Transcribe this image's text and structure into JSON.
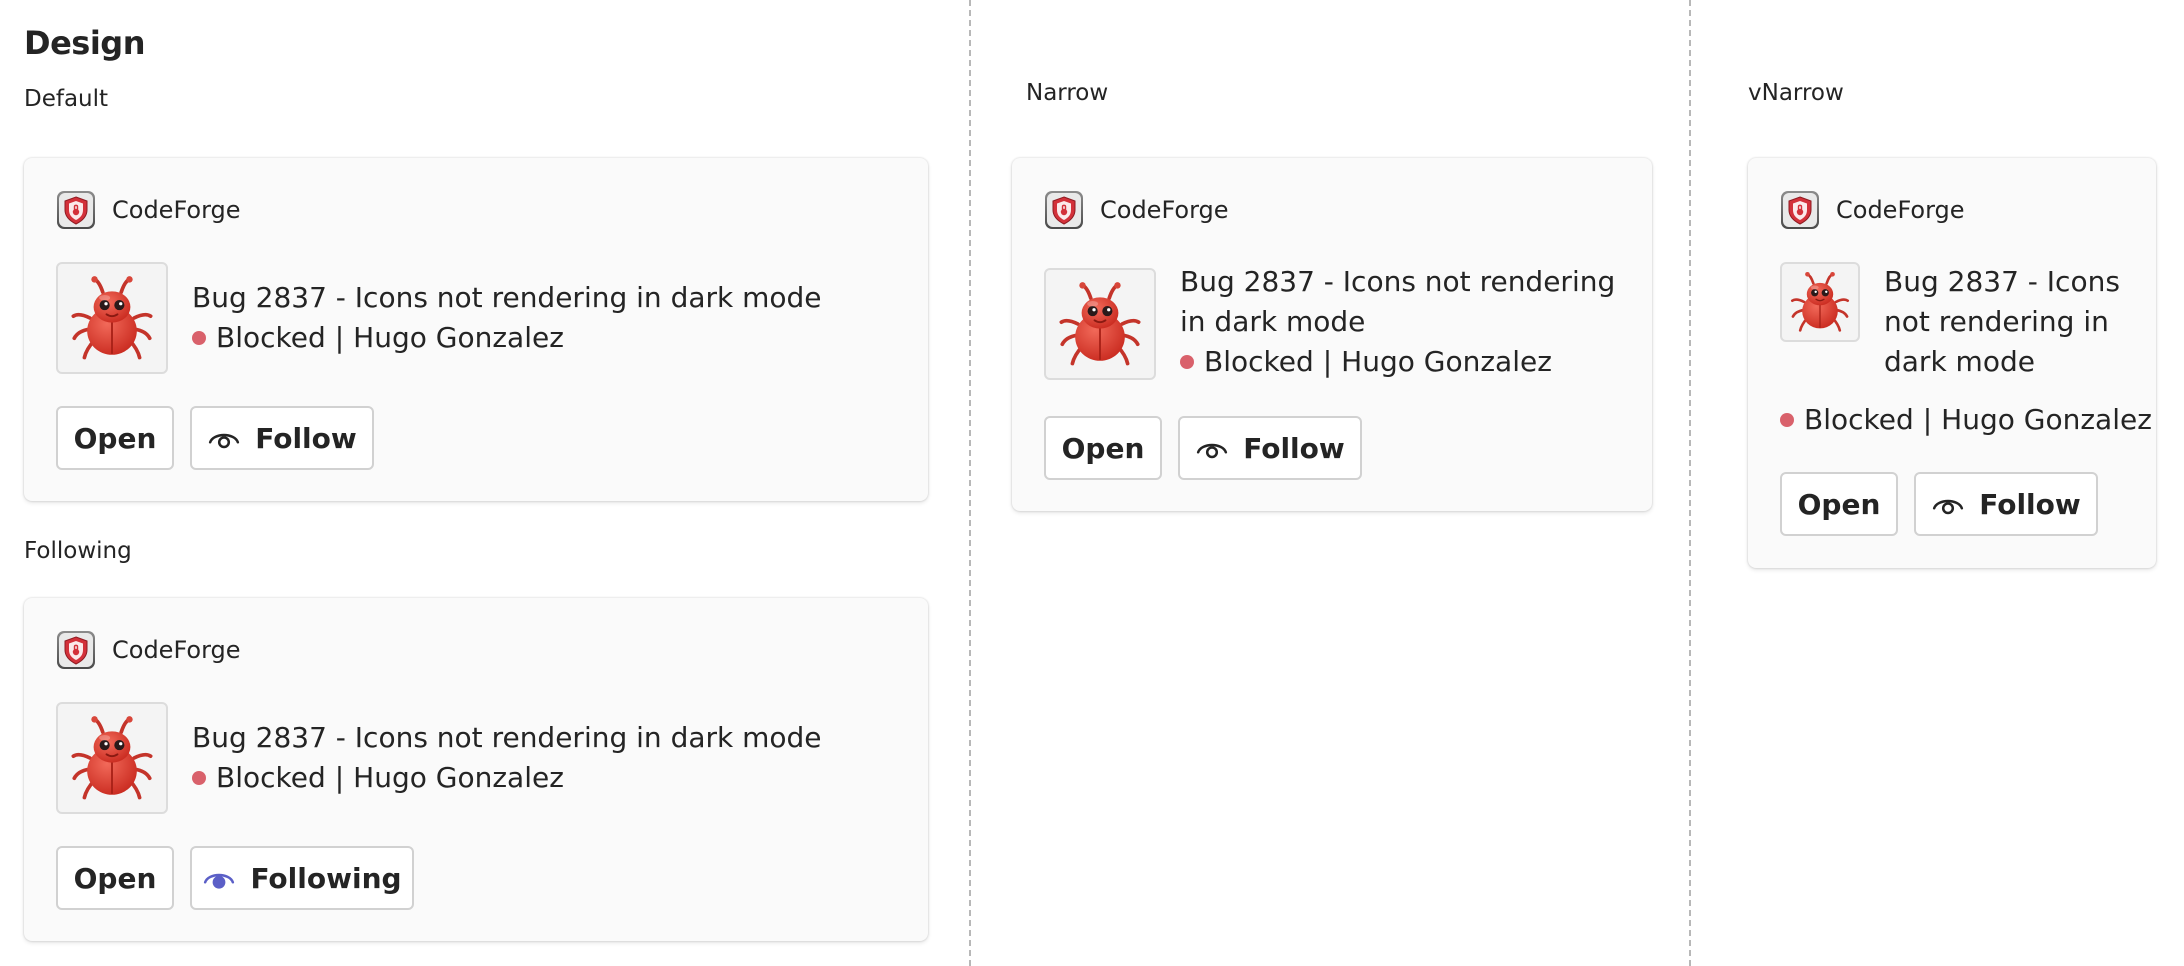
{
  "page_title": "Design",
  "colors": {
    "status_blocked": "#d9616b",
    "following_accent": "#5b5fc7"
  },
  "sections": {
    "default": "Default",
    "following": "Following",
    "narrow": "Narrow",
    "vnarrow": "vNarrow"
  },
  "card": {
    "app_name": "CodeForge",
    "app_icon": "shield-icon",
    "thumbnail": "bug-icon",
    "title": "Bug 2837 - Icons not rendering in dark mode",
    "status": "Blocked",
    "separator": "|",
    "assignee": "Hugo Gonzalez",
    "open_label": "Open",
    "follow_label": "Follow",
    "following_label": "Following"
  }
}
